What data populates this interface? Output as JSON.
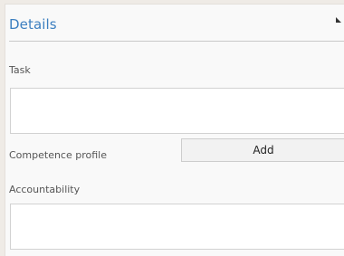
{
  "details": {
    "title": "Details",
    "task_label": "Task",
    "task_value": "",
    "competence_label": "Competence profile",
    "add_label": "Add",
    "accountability_label": "Accountability",
    "accountability_value": ""
  },
  "icons": {
    "collapse": "collapse-corner-icon"
  },
  "colors": {
    "title": "#3c7fc0",
    "background": "#efebe6",
    "panel": "#f9f9f9"
  }
}
